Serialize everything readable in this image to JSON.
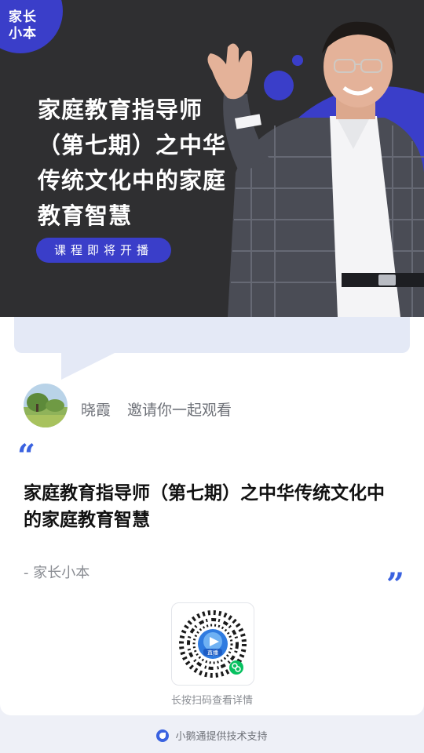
{
  "banner": {
    "logo": "家长\n小本",
    "title": "家庭教育指导师（第七期）之中华传统文化中的家庭教育智慧",
    "badge": "课程即将开播"
  },
  "inviter": {
    "name": "晓霞",
    "message": "邀请你一起观看"
  },
  "quote": {
    "title": "家庭教育指导师（第七期）之中华传统文化中的家庭教育智慧",
    "source": "- 家长小本"
  },
  "qr": {
    "center_label": "直播",
    "hint": "长按扫码查看详情"
  },
  "footer": {
    "text": "小鹅通提供技术支持"
  },
  "colors": {
    "accent": "#3a3ec9",
    "quote": "#3a62e0",
    "banner_bg": "#2f2f31",
    "page_bg": "#eef0f7"
  },
  "icons": [
    "logo-icon",
    "avatar-icon",
    "qr-code-icon",
    "mini-program-icon",
    "xiaoetong-icon"
  ]
}
